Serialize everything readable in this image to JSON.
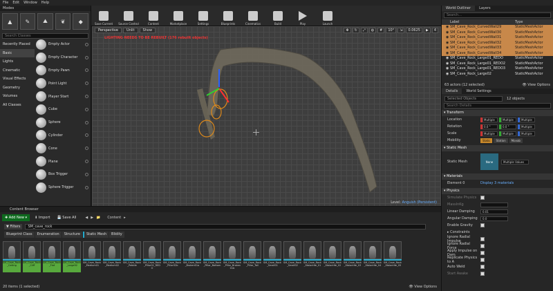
{
  "menu": [
    "File",
    "Edit",
    "Window",
    "Help"
  ],
  "modes": {
    "tab": "Modes",
    "search_placeholder": "Search Classes",
    "categories": [
      "Recently Placed",
      "Basic",
      "Lights",
      "Cinematic",
      "Visual Effects",
      "Geometry",
      "Volumes",
      "All Classes"
    ],
    "items": [
      "Empty Actor",
      "Empty Character",
      "Empty Pawn",
      "Point Light",
      "Player Start",
      "Cube",
      "Sphere",
      "Cylinder",
      "Cone",
      "Plane",
      "Box Trigger",
      "Sphere Trigger"
    ]
  },
  "toolbar": {
    "buttons": [
      "Save Current",
      "Source Control",
      "Content",
      "Marketplace",
      "Settings",
      "Blueprints",
      "Cinematics",
      "Build",
      "Play",
      "Launch"
    ]
  },
  "viewport": {
    "buttons": [
      "Perspective",
      "Unlit",
      "Show"
    ],
    "right_buttons": [
      "10°",
      "0.0625",
      "4"
    ],
    "warning": "LIGHTING NEEDS TO BE REBUILT (176 rebuilt objects)",
    "level_label": "Level:",
    "level_name": "Anguish (Persistent)"
  },
  "content_browser": {
    "tab": "Content Browser",
    "add_new": "Add New",
    "import": "Import",
    "save_all": "Save All",
    "path": "Content",
    "filters": "Filters",
    "search_value": "SM_cave_rock",
    "type_tabs": [
      "Blueprint Class",
      "Enumeration",
      "Structure",
      "Static Mesh",
      "Blidity"
    ],
    "assets": [
      {
        "name": "SM_Cave_Rock_Ceiling",
        "selected": true
      },
      {
        "name": "SM_Cave_Rock_Cliff",
        "selected": true
      },
      {
        "name": "SM_Cave_Rock_Flat",
        "selected": true
      },
      {
        "name": "SM_Cave_Rock_Large02",
        "selected": true
      },
      {
        "name": "SM_Cave_Rock_Medium01",
        "selected": false
      },
      {
        "name": "SM_Cave_Rock_Medium02",
        "selected": false
      },
      {
        "name": "SM_Cave_Rock_Pebble",
        "selected": false
      },
      {
        "name": "SM_Cave_Rock_Pillar01_REDO",
        "selected": false
      },
      {
        "name": "SM_Cave_Rock_Pillar02b",
        "selected": false
      },
      {
        "name": "SM_Cave_Rock_Broken01a",
        "selected": false
      },
      {
        "name": "SM_Cave_Rock_Pillar_Bottom",
        "selected": false
      },
      {
        "name": "SM_Cave_Rock_Pillar_Broken01b",
        "selected": false
      },
      {
        "name": "SM_Cave_Rock_Pillar_Tall",
        "selected": false
      },
      {
        "name": "SM_Cave_Rock_Small01",
        "selected": false
      },
      {
        "name": "SM_Cave_Rock_Small02",
        "selected": false
      },
      {
        "name": "SM_Cave_Rock_Stalactite_01",
        "selected": false
      },
      {
        "name": "SM_Cave_Rock_Stalactite_02",
        "selected": false
      },
      {
        "name": "SM_Cave_Rock_Stalactite_03",
        "selected": false
      },
      {
        "name": "SM_Cave_Rock_Stalactite_04",
        "selected": false
      },
      {
        "name": "SM_Cave_Rock_Stalactite_05",
        "selected": false
      }
    ],
    "status": "20 items (1 selected)",
    "view_options": "View Options"
  },
  "outliner": {
    "tabs": [
      "World Outliner",
      "Layers"
    ],
    "search_placeholder": "Search...",
    "col_label": "Label",
    "col_type": "Type",
    "rows": [
      {
        "label": "SM_Cave_Rock_CurvedWall29",
        "type": "StaticMeshActor",
        "selected": true
      },
      {
        "label": "SM_Cave_Rock_CurvedWall30",
        "type": "StaticMeshActor",
        "selected": true
      },
      {
        "label": "SM_Cave_Rock_CurvedWall31",
        "type": "StaticMeshActor",
        "selected": true
      },
      {
        "label": "SM_Cave_Rock_CurvedWall32",
        "type": "StaticMeshActor",
        "selected": true
      },
      {
        "label": "SM_Cave_Rock_CurvedWall33",
        "type": "StaticMeshActor",
        "selected": true
      },
      {
        "label": "SM_Cave_Rock_CurvedWall34",
        "type": "StaticMeshActor",
        "selected": true
      },
      {
        "label": "SM_Cave_Rock_Large01_REDO",
        "type": "StaticMeshActor",
        "selected": false
      },
      {
        "label": "SM_Cave_Rock_Large01_REDO2",
        "type": "StaticMeshActor",
        "selected": false
      },
      {
        "label": "SM_Cave_Rock_Large01_REDO3",
        "type": "StaticMeshActor",
        "selected": false
      },
      {
        "label": "SM_Cave_Rock_Large02",
        "type": "StaticMeshActor",
        "selected": false
      }
    ],
    "footer": "63 actors (12 selected)",
    "view_options": "View Options"
  },
  "details": {
    "tabs": [
      "Details",
      "World Settings"
    ],
    "selected_placeholder": "Selected Objects",
    "selected_count": "12 objects",
    "search_placeholder": "Search Details",
    "transform": "Transform",
    "location": "Location",
    "rotation": "Rotation",
    "scale": "Scale",
    "multiple": "Multiple",
    "rot_x": "0.0 °",
    "rot_y": "0.0 °",
    "mobility": "Mobility",
    "mobility_opts": [
      "Static",
      "Station",
      "Movab"
    ],
    "static_mesh_sec": "Static Mesh",
    "static_mesh": "Static Mesh",
    "mesh_thumb": "None",
    "mesh_value": "Multiple Values",
    "materials_sec": "Materials",
    "element0": "Element 0",
    "display_mats": "Display 3 materials",
    "physics_sec": "Physics",
    "sim_physics": "Simulate Physics",
    "mass": "MassInKg",
    "linear_damping": "Linear Damping",
    "linear_damping_val": "0.01",
    "angular_damping": "Angular Damping",
    "angular_damping_val": "0.0",
    "enable_gravity": "Enable Gravity",
    "constraints": "Constraints",
    "ignore_radial_impulse": "Ignore Radial Impulse",
    "ignore_radial_force": "Ignore Radial Force",
    "apply_impulse": "Apply Impulse on Dam",
    "replicate_physics": "Replicate Physics to A",
    "auto_weld": "Auto Weld",
    "start_awake": "Start Awake"
  }
}
